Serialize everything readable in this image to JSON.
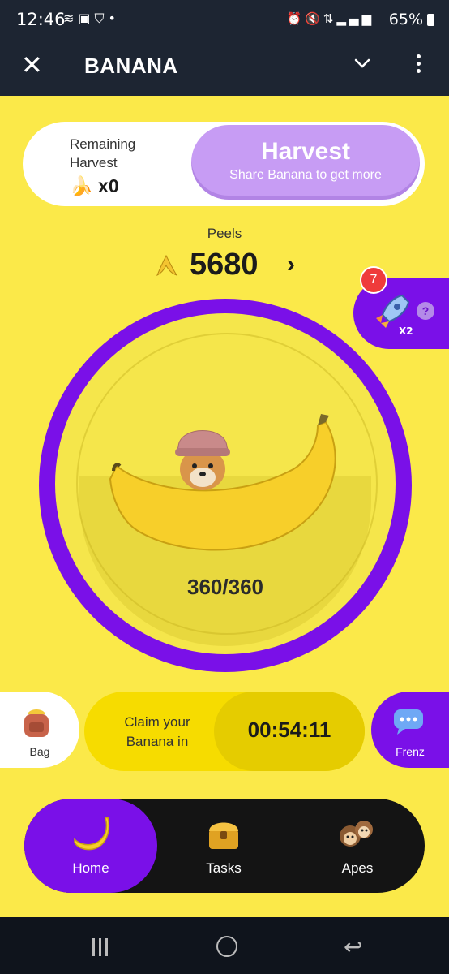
{
  "status_bar": {
    "time": "12:46",
    "left_icons": [
      "notification-icon",
      "app-icon",
      "shield-icon",
      "dot-icon"
    ],
    "right_icons": [
      "alarm-icon",
      "mute-icon",
      "4g-icon",
      "signal-icon"
    ],
    "battery": "65%"
  },
  "app_bar": {
    "title": "BANANA",
    "close_icon": "close-icon",
    "chevron_icon": "chevron-down-icon",
    "more_icon": "more-vertical-icon"
  },
  "harvest": {
    "remaining_label": "Remaining Harvest",
    "remaining_count": "x0",
    "button_title": "Harvest",
    "button_subtitle": "Share Banana to get more"
  },
  "peels": {
    "label": "Peels",
    "value": "5680",
    "arrow": "›"
  },
  "boost": {
    "badge": "7",
    "multiplier": "X2",
    "help": "?"
  },
  "tap": {
    "energy": "360/360"
  },
  "bag": {
    "label": "Bag"
  },
  "claim": {
    "text": "Claim your Banana in",
    "timer": "00:54:11"
  },
  "frenz": {
    "label": "Frenz"
  },
  "nav": {
    "items": [
      {
        "label": "Home",
        "icon": "banana-icon",
        "active": true
      },
      {
        "label": "Tasks",
        "icon": "treasure-chest-icon",
        "active": false
      },
      {
        "label": "Apes",
        "icon": "monkeys-icon",
        "active": false
      }
    ]
  },
  "colors": {
    "background": "#FBE949",
    "purple": "#7A10E8",
    "harvest_button": "#C79CF4",
    "claim": "#F6DC00",
    "nav_bg": "#141414",
    "topbar": "#1d2532"
  }
}
